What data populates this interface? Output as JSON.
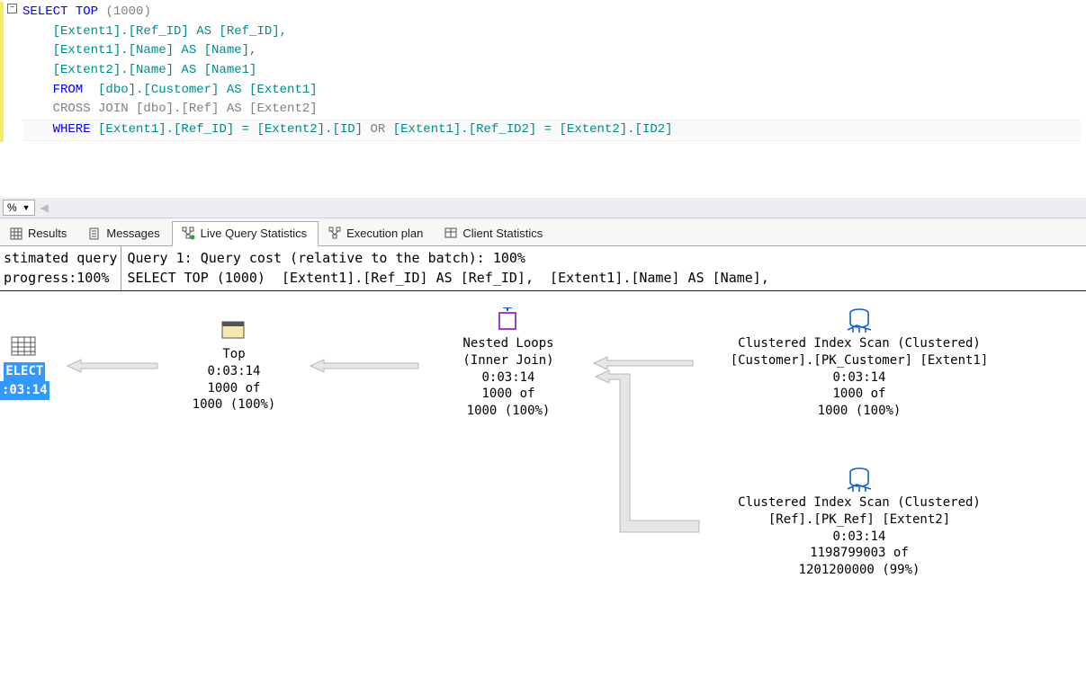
{
  "editor": {
    "line1_select": "SELECT",
    "line1_top": " TOP ",
    "line1_paren_open": "(",
    "line1_num": "1000",
    "line1_paren_close": ")",
    "line2": "    [Extent1].[Ref_ID] AS [Ref_ID], ",
    "line3": "    [Extent1].[Name] AS [Name], ",
    "line4": "    [Extent2].[Name] AS [Name1]",
    "line5_from": "    FROM ",
    "line5_rest": " [dbo].[Customer] AS [Extent1]",
    "line6": "    CROSS JOIN [dbo].[Ref] AS [Extent2]",
    "line7_where": "    WHERE ",
    "line7_mid1": "[Extent1].[Ref_ID] = [Extent2].[ID] ",
    "line7_or": "OR",
    "line7_mid2": " [Extent1].[Ref_ID2] = [Extent2].[ID2]"
  },
  "zoom": {
    "value": "%"
  },
  "tabs": {
    "results": "Results",
    "messages": "Messages",
    "live": "Live Query Statistics",
    "exec": "Execution plan",
    "client": "Client Statistics"
  },
  "plan_header": {
    "left_line1": "stimated query",
    "left_line2": "progress:100%",
    "right_line1": "Query 1: Query cost (relative to the batch): 100%",
    "right_line2": "SELECT TOP (1000)  [Extent1].[Ref_ID] AS [Ref_ID],  [Extent1].[Name] AS [Name],"
  },
  "nodes": {
    "select": {
      "label": "ELECT",
      "time": ":03:14"
    },
    "top": {
      "title": "Top",
      "time": "0:03:14",
      "row1": "1000 of",
      "row2": "1000 (100%)"
    },
    "nested": {
      "title": "Nested Loops",
      "sub": "(Inner Join)",
      "time": "0:03:14",
      "row1": "1000 of",
      "row2": "1000 (100%)"
    },
    "scan1": {
      "title": "Clustered Index Scan (Clustered)",
      "sub": "[Customer].[PK_Customer] [Extent1]",
      "time": "0:03:14",
      "row1": "1000 of",
      "row2": "1000 (100%)"
    },
    "scan2": {
      "title": "Clustered Index Scan (Clustered)",
      "sub": "[Ref].[PK_Ref] [Extent2]",
      "time": "0:03:14",
      "row1": "1198799003 of",
      "row2": "1201200000 (99%)"
    }
  }
}
